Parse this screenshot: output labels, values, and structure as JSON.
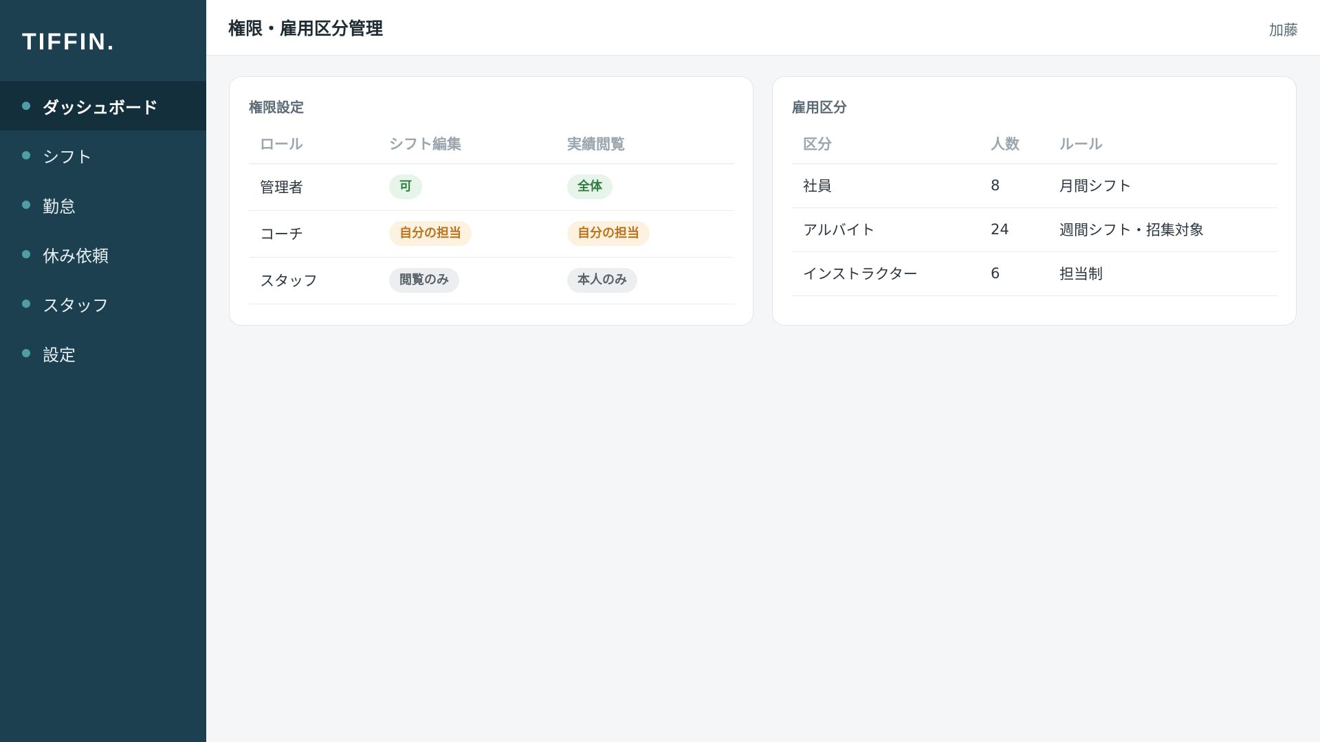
{
  "app": {
    "logo": "TIFFIN."
  },
  "sidebar": {
    "items": [
      {
        "label": "ダッシュボード",
        "active": true
      },
      {
        "label": "シフト"
      },
      {
        "label": "勤怠"
      },
      {
        "label": "休み依頼"
      },
      {
        "label": "スタッフ"
      },
      {
        "label": "設定"
      }
    ]
  },
  "header": {
    "title": "権限・雇用区分管理",
    "user": "加藤"
  },
  "permissions": {
    "title": "権限設定",
    "columns": [
      "ロール",
      "シフト編集",
      "実績閲覧"
    ],
    "rows": [
      {
        "role": "管理者",
        "shift_edit": "可",
        "shift_edit_status": "green",
        "results_view": "全体",
        "results_view_status": "green"
      },
      {
        "role": "コーチ",
        "shift_edit": "自分の担当",
        "shift_edit_status": "orange",
        "results_view": "自分の担当",
        "results_view_status": "orange"
      },
      {
        "role": "スタッフ",
        "shift_edit": "閲覧のみ",
        "shift_edit_status": "gray",
        "results_view": "本人のみ",
        "results_view_status": "gray"
      }
    ]
  },
  "employment": {
    "title": "雇用区分",
    "columns": [
      "区分",
      "人数",
      "ルール"
    ],
    "rows": [
      {
        "type": "社員",
        "count": "8",
        "rule": "月間シフト"
      },
      {
        "type": "アルバイト",
        "count": "24",
        "rule": "週間シフト・招集対象"
      },
      {
        "type": "インストラクター",
        "count": "6",
        "rule": "担当制"
      }
    ]
  },
  "colors": {
    "sidebar_bg": "#1c4050",
    "sidebar_active": "#142f3c",
    "accent_dot": "#4f9ea6",
    "badge_green": "#2f7d3e",
    "badge_orange": "#b9741d",
    "badge_gray": "#59626a"
  }
}
